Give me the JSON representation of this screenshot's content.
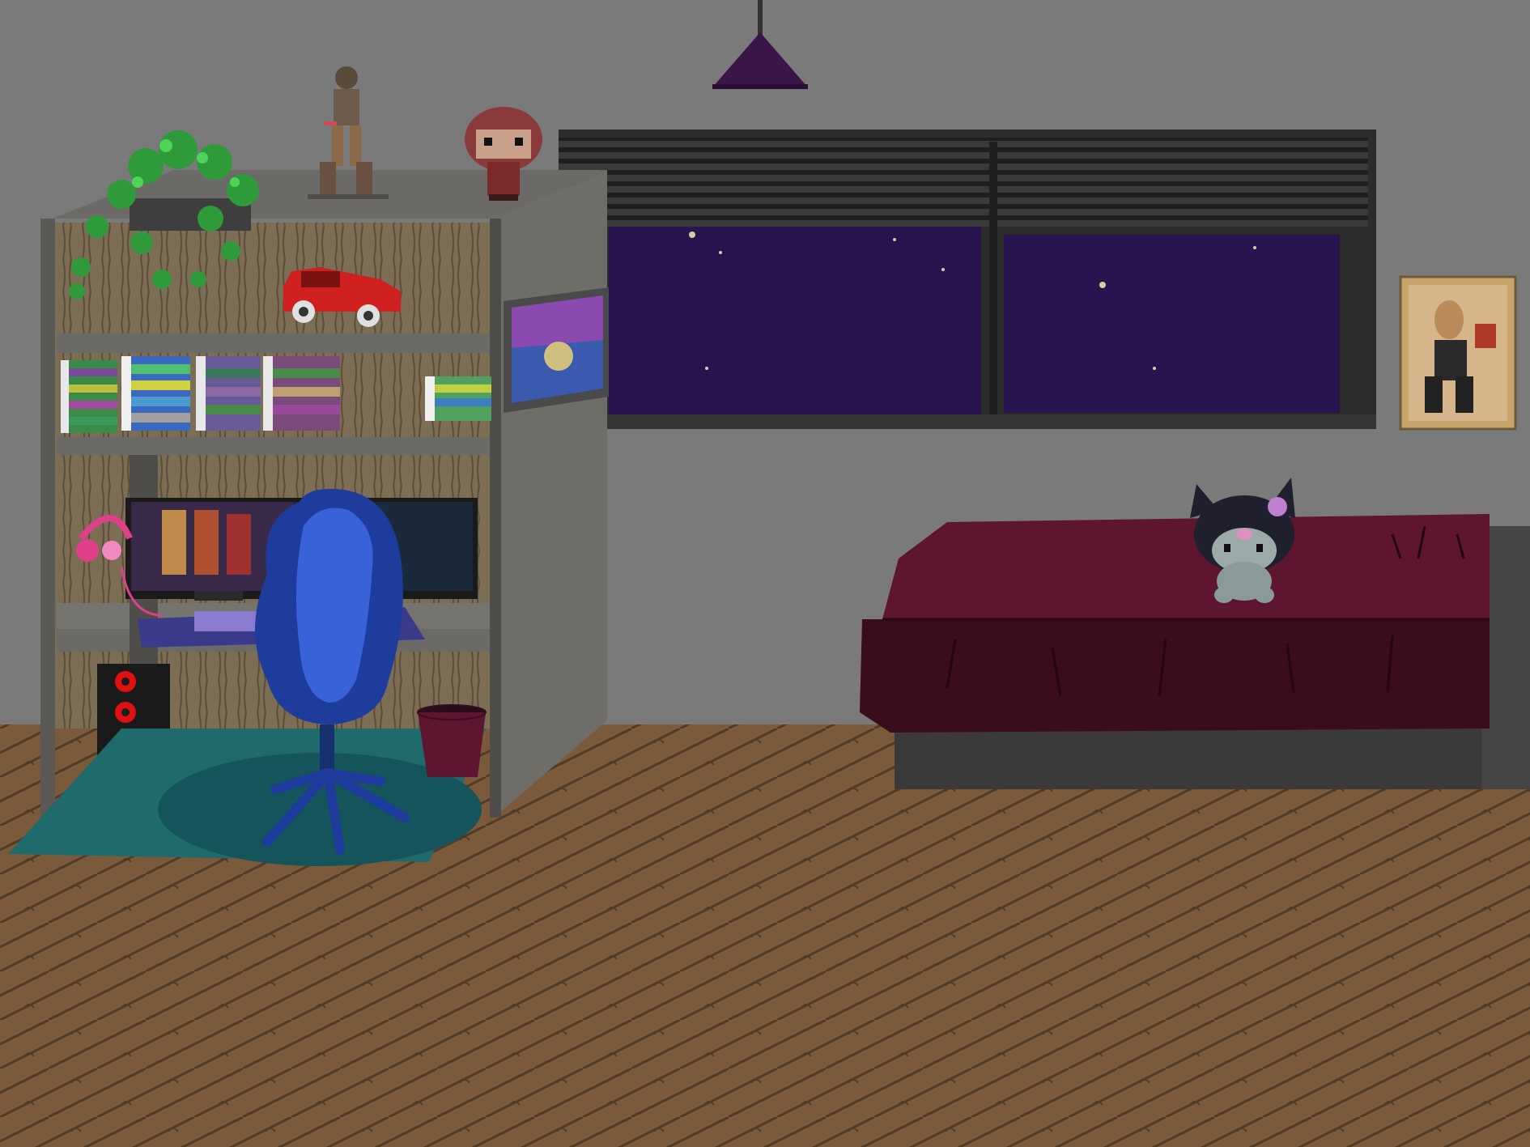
{
  "scene": {
    "type": "pixel-art bedroom",
    "time_of_day": "night"
  },
  "colors": {
    "wall": "#7a7a7a",
    "floor": "#7a5a3a",
    "floor_lines": "#4a3a2a",
    "night_sky": "#2a1450",
    "shelf": "#6b6a66",
    "shelf_dark": "#4e4d49",
    "chair": "#1d3c9c",
    "rug": "#1f6a6a",
    "bedspread": "#5e1530",
    "bedspread_dark": "#3a0c1c",
    "lamp": "#3a1548",
    "headphones": "#e0408a",
    "pc_lights": "#e01010"
  },
  "objects": [
    {
      "name": "pendant-lamp"
    },
    {
      "name": "window-with-blinds"
    },
    {
      "name": "bookshelf-desk"
    },
    {
      "name": "hanging-plant"
    },
    {
      "name": "assassin-figure"
    },
    {
      "name": "witch-figure"
    },
    {
      "name": "toy-car"
    },
    {
      "name": "wall-tablet"
    },
    {
      "name": "gaming-monitors"
    },
    {
      "name": "pink-headphones"
    },
    {
      "name": "pc-tower"
    },
    {
      "name": "gaming-chair"
    },
    {
      "name": "trash-bin"
    },
    {
      "name": "rug"
    },
    {
      "name": "bed"
    },
    {
      "name": "plush-toy"
    },
    {
      "name": "fighter-poster"
    }
  ]
}
